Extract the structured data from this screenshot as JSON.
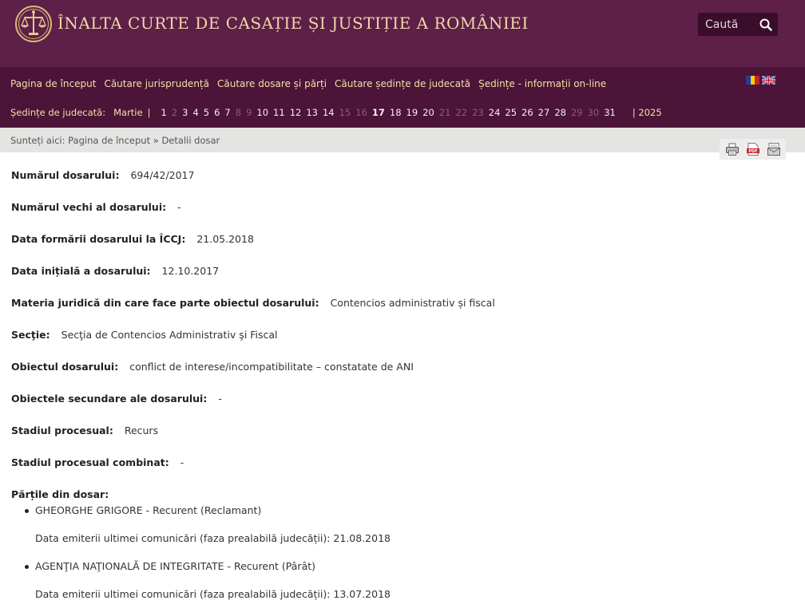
{
  "header": {
    "title": "ÎNALTA CURTE DE CASAȚIE ȘI JUSTIȚIE A ROMÂNIEI",
    "logo_icon": "scales-of-justice-icon",
    "search": {
      "placeholder": "Caută"
    }
  },
  "nav": {
    "links": [
      "Pagina de început",
      "Căutare jurisprudență",
      "Căutare dosare și părți",
      "Căutare ședințe de judecată",
      "Ședințe - informații on-line"
    ],
    "flags": [
      "flag-romania-icon",
      "flag-uk-icon"
    ]
  },
  "sessions": {
    "label": "Ședințe de judecată:",
    "month": "Martie",
    "separator": "|",
    "current_day": "17",
    "days": [
      {
        "d": "1",
        "active": true
      },
      {
        "d": "2",
        "active": false
      },
      {
        "d": "3",
        "active": true
      },
      {
        "d": "4",
        "active": true
      },
      {
        "d": "5",
        "active": true
      },
      {
        "d": "6",
        "active": true
      },
      {
        "d": "7",
        "active": true
      },
      {
        "d": "8",
        "active": false
      },
      {
        "d": "9",
        "active": false
      },
      {
        "d": "10",
        "active": true
      },
      {
        "d": "11",
        "active": true
      },
      {
        "d": "12",
        "active": true
      },
      {
        "d": "13",
        "active": true
      },
      {
        "d": "14",
        "active": true
      },
      {
        "d": "15",
        "active": false
      },
      {
        "d": "16",
        "active": false
      },
      {
        "d": "17",
        "active": true
      },
      {
        "d": "18",
        "active": true
      },
      {
        "d": "19",
        "active": true
      },
      {
        "d": "20",
        "active": true
      },
      {
        "d": "21",
        "active": false
      },
      {
        "d": "22",
        "active": false
      },
      {
        "d": "23",
        "active": false
      },
      {
        "d": "24",
        "active": true
      },
      {
        "d": "25",
        "active": true
      },
      {
        "d": "26",
        "active": true
      },
      {
        "d": "27",
        "active": true
      },
      {
        "d": "28",
        "active": true
      },
      {
        "d": "29",
        "active": false
      },
      {
        "d": "30",
        "active": false
      },
      {
        "d": "31",
        "active": true
      }
    ],
    "year": "| 2025"
  },
  "breadcrumb": {
    "prefix": "Sunteți aici:",
    "home": "Pagina de început",
    "divider": "»",
    "current": "Detalii dosar"
  },
  "tools": [
    "print-icon",
    "pdf-icon",
    "email-icon"
  ],
  "case": {
    "fields": [
      {
        "label": "Numărul dosarului:",
        "value": "694/42/2017"
      },
      {
        "label": "Numărul vechi al dosarului:",
        "value": "-"
      },
      {
        "label": "Data formării dosarului la ÎCCJ:",
        "value": "21.05.2018"
      },
      {
        "label": "Data inițială a dosarului:",
        "value": "12.10.2017"
      },
      {
        "label": "Materia juridică din care face parte obiectul dosarului:",
        "value": "Contencios administrativ și fiscal"
      },
      {
        "label": "Secţie:",
        "value": "Secţia de Contencios Administrativ şi Fiscal"
      },
      {
        "label": "Obiectul dosarului:",
        "value": "conflict de interese/incompatibilitate – constatate de ANI"
      },
      {
        "label": "Obiectele secundare ale dosarului:",
        "value": "-"
      },
      {
        "label": "Stadiul procesual:",
        "value": "Recurs"
      },
      {
        "label": "Stadiul procesual combinat:",
        "value": "-"
      }
    ],
    "parties_title": "Părțile din dosar:",
    "parties": [
      {
        "name": "GHEORGHE GRIGORE - Recurent (Reclamant)",
        "date": "Data emiterii ultimei comunicări (faza prealabilă judecății): 21.08.2018"
      },
      {
        "name": "AGENŢIA NAŢIONALĂ DE INTEGRITATE - Recurent (Pârât)",
        "date": "Data emiterii ultimei comunicări (faza prealabilă judecății): 13.07.2018"
      }
    ]
  }
}
